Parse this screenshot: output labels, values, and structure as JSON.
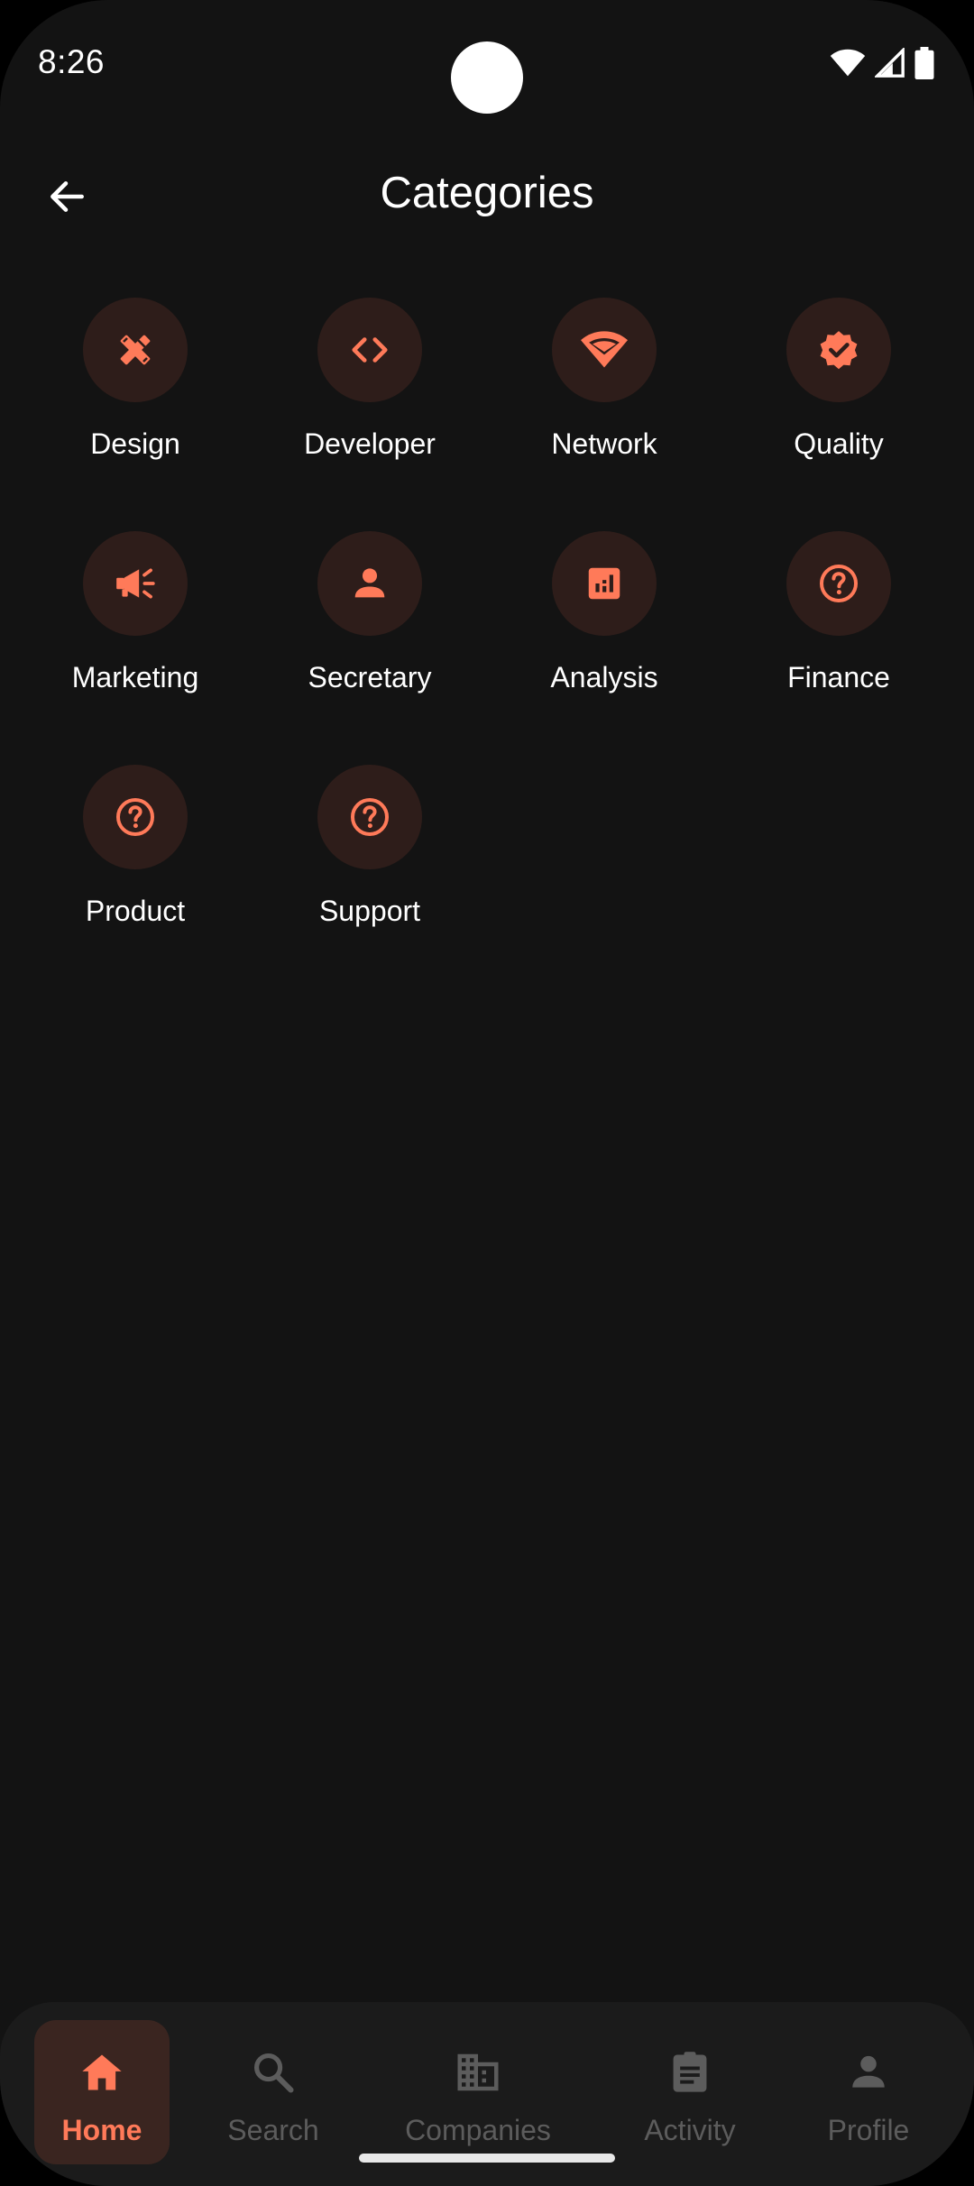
{
  "status_bar": {
    "time": "8:26",
    "icons": [
      "wifi-icon",
      "cell-signal-icon",
      "battery-icon"
    ]
  },
  "header": {
    "back_icon": "arrow-back-icon",
    "title": "Categories"
  },
  "categories": [
    {
      "label": "Design",
      "icon": "design-tools-icon"
    },
    {
      "label": "Developer",
      "icon": "code-icon"
    },
    {
      "label": "Network",
      "icon": "wifi-icon"
    },
    {
      "label": "Quality",
      "icon": "verified-badge-icon"
    },
    {
      "label": "Marketing",
      "icon": "campaign-megaphone-icon"
    },
    {
      "label": "Secretary",
      "icon": "person-icon"
    },
    {
      "label": "Analysis",
      "icon": "analytics-chart-icon"
    },
    {
      "label": "Finance",
      "icon": "help-circle-icon"
    },
    {
      "label": "Product",
      "icon": "help-circle-icon"
    },
    {
      "label": "Support",
      "icon": "help-circle-icon"
    }
  ],
  "bottom_nav": {
    "items": [
      {
        "label": "Home",
        "icon": "home-icon",
        "active": true
      },
      {
        "label": "Search",
        "icon": "search-icon",
        "active": false
      },
      {
        "label": "Companies",
        "icon": "building-icon",
        "active": false
      },
      {
        "label": "Activity",
        "icon": "assignment-icon",
        "active": false
      },
      {
        "label": "Profile",
        "icon": "person-icon",
        "active": false
      }
    ]
  },
  "colors": {
    "background": "#131313",
    "accent": "#ff7a59",
    "icon_circle": "#2e1d1a",
    "nav_background": "#1b1b1b",
    "nav_inactive": "#5c5c5c"
  }
}
